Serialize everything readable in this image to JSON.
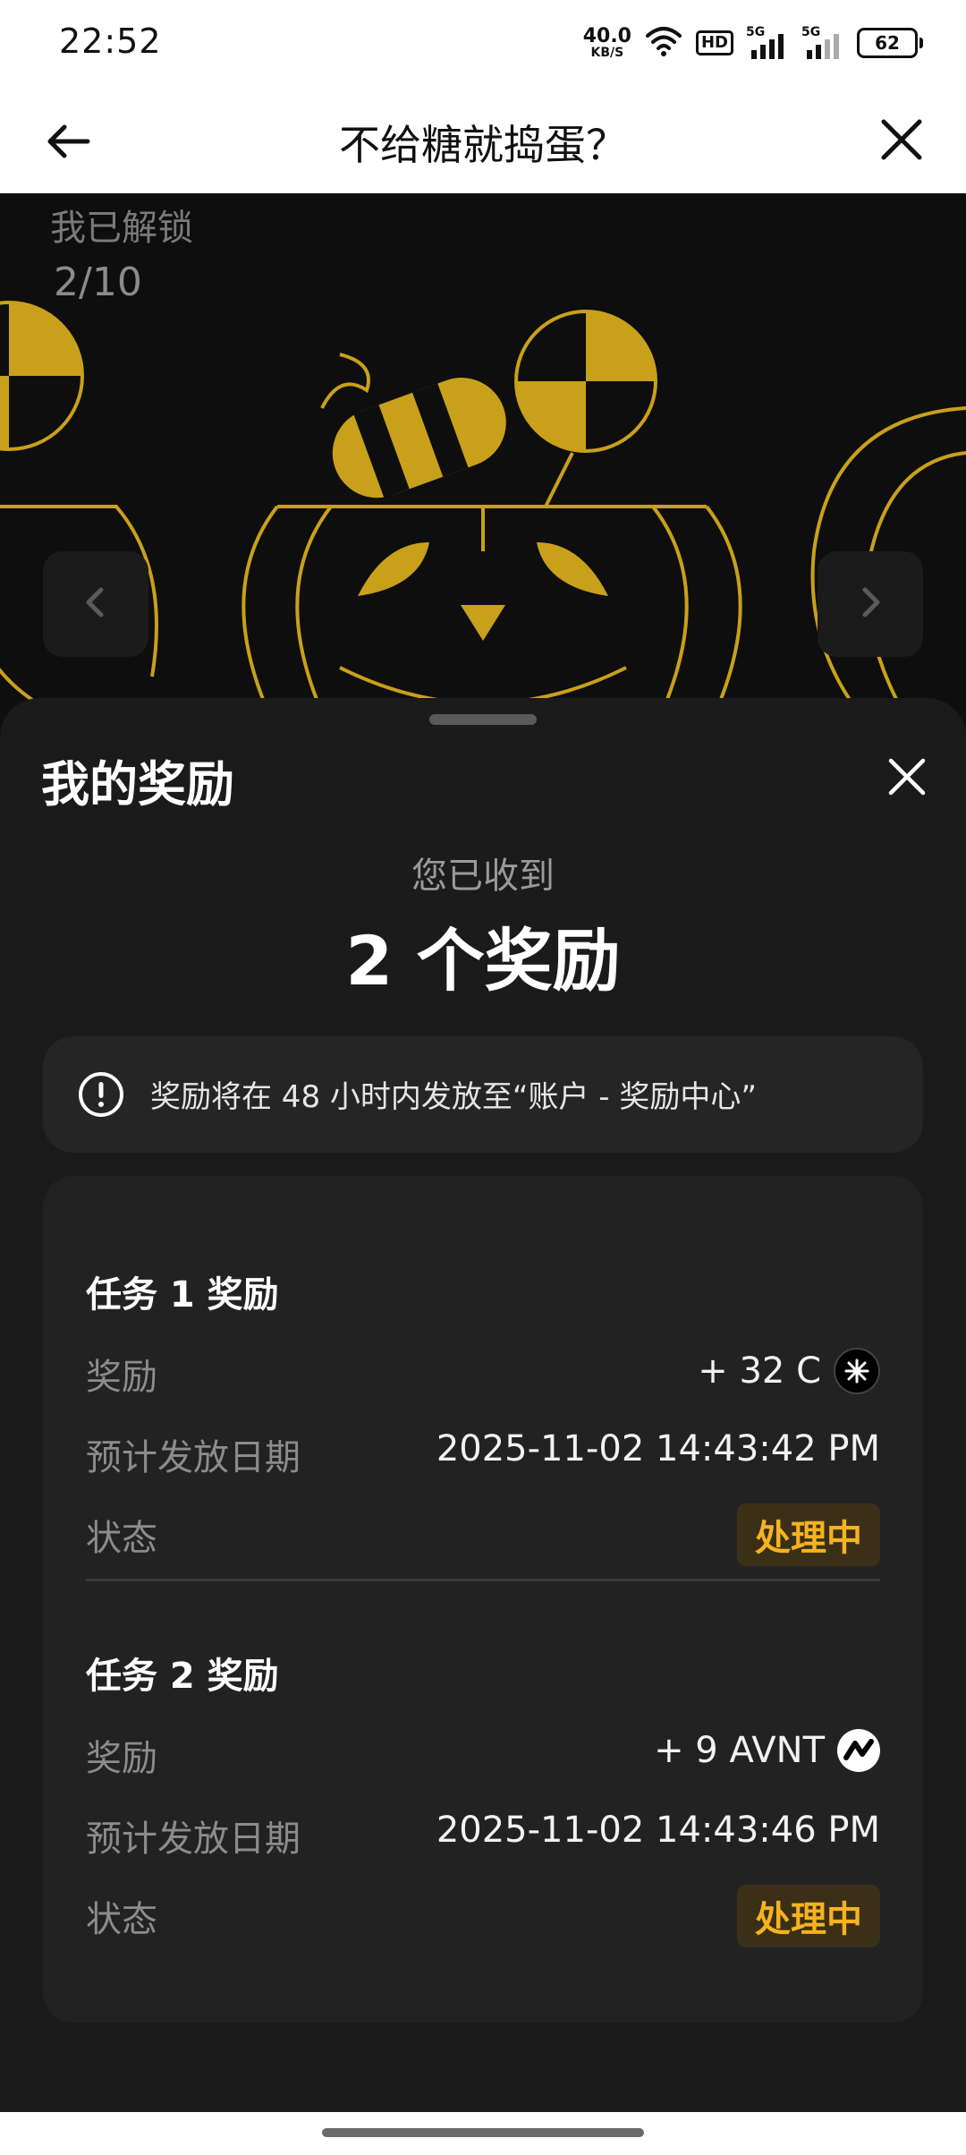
{
  "status_bar": {
    "time": "22:52",
    "net_speed_value": "40.0",
    "net_speed_unit": "KB/S",
    "hd_label": "HD",
    "signal_1_label": "5G",
    "signal_2_label": "5G",
    "battery": "62",
    "icons": [
      "wifi-icon",
      "hd-icon",
      "signal-icon",
      "signal-icon",
      "battery-icon"
    ]
  },
  "header": {
    "title": "不给糖就捣蛋？",
    "icons": [
      "back-arrow-icon",
      "close-icon"
    ]
  },
  "hero": {
    "unlock_label": "我已解锁",
    "unlock_count": "2/10",
    "icons": [
      "chevron-left-icon",
      "chevron-right-icon"
    ],
    "accent_color": "#c9a01a"
  },
  "sheet": {
    "title": "我的奖励",
    "received_label": "您已收到",
    "reward_count": "2 个奖励",
    "notice": "奖励将在 48 小时内发放至“账户 - 奖励中心”",
    "tasks": [
      {
        "title": "任务 1 奖励",
        "reward_label": "奖励",
        "reward_value": "+ 32 C",
        "coin_icon": "c-token-icon",
        "date_label": "预计发放日期",
        "date_value": "2025-11-02 14:43:42 PM",
        "status_label": "状态",
        "status_value": "处理中"
      },
      {
        "title": "任务 2 奖励",
        "reward_label": "奖励",
        "reward_value": "+ 9 AVNT",
        "coin_icon": "avnt-token-icon",
        "date_label": "预计发放日期",
        "date_value": "2025-11-02 14:43:46 PM",
        "status_label": "状态",
        "status_value": "处理中"
      }
    ],
    "status_color": "#f5b31f"
  }
}
